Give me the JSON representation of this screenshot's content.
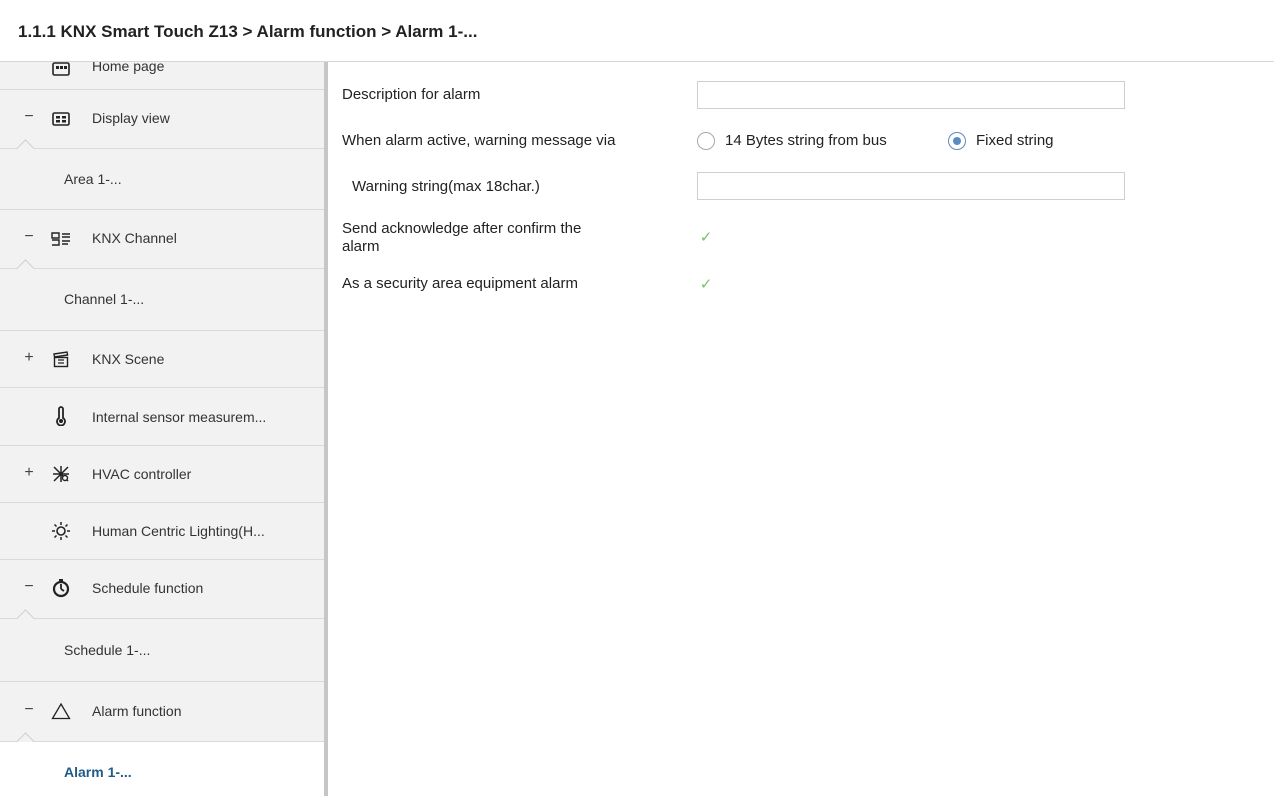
{
  "header": {
    "title": "1.1.1 KNX Smart Touch Z13 > Alarm function > Alarm 1-..."
  },
  "sidebar": {
    "items": [
      {
        "label": "Home page",
        "icon": "home-page-icon",
        "expander": ""
      },
      {
        "label": "Display view",
        "icon": "display-view-icon",
        "expander": "−"
      },
      {
        "label": "Area 1-...",
        "icon": "",
        "expander": ""
      },
      {
        "label": "KNX Channel",
        "icon": "knx-channel-icon",
        "expander": "−"
      },
      {
        "label": "Channel 1-...",
        "icon": "",
        "expander": ""
      },
      {
        "label": "KNX Scene",
        "icon": "clapperboard-icon",
        "expander": "+"
      },
      {
        "label": "Internal sensor measurem...",
        "icon": "thermometer-icon",
        "expander": ""
      },
      {
        "label": "HVAC controller",
        "icon": "hvac-icon",
        "expander": "+"
      },
      {
        "label": "Human Centric Lighting(H...",
        "icon": "sun-icon",
        "expander": ""
      },
      {
        "label": "Schedule function",
        "icon": "timer-icon",
        "expander": "−"
      },
      {
        "label": "Schedule 1-...",
        "icon": "",
        "expander": ""
      },
      {
        "label": "Alarm function",
        "icon": "warning-triangle-icon",
        "expander": "−"
      },
      {
        "label": "Alarm 1-...",
        "icon": "",
        "expander": ""
      }
    ]
  },
  "form": {
    "description": {
      "label": "Description for alarm",
      "value": ""
    },
    "warning_via": {
      "label": "When alarm active, warning message via",
      "option_bus": "14 Bytes string from bus",
      "option_fixed": "Fixed string",
      "selected": "Fixed string"
    },
    "warning_string": {
      "label": "Warning string(max 18char.)",
      "value": ""
    },
    "send_ack": {
      "label_line1": "Send acknowledge after confirm the",
      "label_line2": "alarm",
      "checked": true
    },
    "security_alarm": {
      "label": "As a security area equipment alarm",
      "checked": true
    }
  },
  "colors": {
    "accent": "#1f5c8b",
    "check": "#7bbf6a",
    "radio_selected": "#5a8cc2"
  }
}
